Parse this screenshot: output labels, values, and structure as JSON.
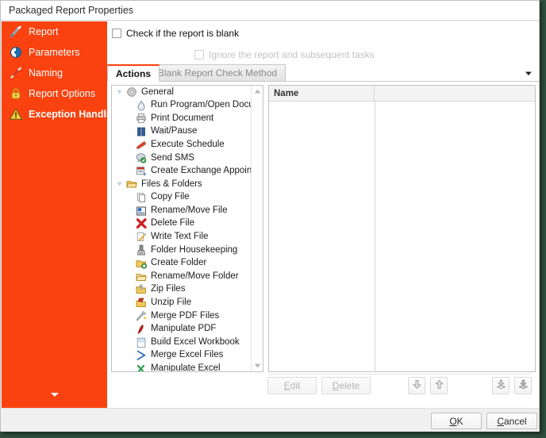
{
  "window": {
    "title": "Packaged Report Properties",
    "accent_color": "#f9420f",
    "sidebar_chevron_icon": "chevron-down-icon"
  },
  "sidebar": {
    "items": [
      {
        "label": "Report",
        "icon": "report-pencil-icon",
        "selected": false
      },
      {
        "label": "Parameters",
        "icon": "parameters-icon",
        "selected": false
      },
      {
        "label": "Naming",
        "icon": "naming-pencil-icon",
        "selected": false
      },
      {
        "label": "Report Options",
        "icon": "padlock-icon",
        "selected": false
      },
      {
        "label": "Exception Handling",
        "icon": "warning-triangle-icon",
        "selected": true
      }
    ]
  },
  "options": {
    "check_blank": {
      "label": "Check if the report is blank",
      "checked": false,
      "disabled": false
    },
    "ignore_report": {
      "label": "Ignore the report and subsequent tasks",
      "checked": false,
      "disabled": true
    }
  },
  "tabs": {
    "items": [
      {
        "label": "Actions",
        "active": true
      },
      {
        "label": "Blank Report Check Method",
        "active": false
      }
    ],
    "overflow_icon": "chevron-down-icon"
  },
  "tree": {
    "groups": [
      {
        "label": "General",
        "icon": "gear-icon",
        "expanded": true,
        "items": [
          {
            "label": "Run Program/Open Document",
            "icon": "run-program-icon"
          },
          {
            "label": "Print Document",
            "icon": "printer-icon"
          },
          {
            "label": "Wait/Pause",
            "icon": "pause-icon"
          },
          {
            "label": "Execute Schedule",
            "icon": "execute-schedule-icon"
          },
          {
            "label": "Send SMS",
            "icon": "send-sms-icon"
          },
          {
            "label": "Create Exchange Appointment",
            "icon": "exchange-appointment-icon"
          }
        ]
      },
      {
        "label": "Files & Folders",
        "icon": "open-folder-icon",
        "expanded": true,
        "items": [
          {
            "label": "Copy File",
            "icon": "copy-file-icon"
          },
          {
            "label": "Rename/Move File",
            "icon": "rename-move-file-icon"
          },
          {
            "label": "Delete File",
            "icon": "delete-file-icon"
          },
          {
            "label": "Write Text File",
            "icon": "write-text-file-icon"
          },
          {
            "label": "Folder Housekeeping",
            "icon": "folder-housekeeping-icon"
          },
          {
            "label": "Create Folder",
            "icon": "create-folder-icon"
          },
          {
            "label": "Rename/Move Folder",
            "icon": "rename-move-folder-icon"
          },
          {
            "label": "Zip Files",
            "icon": "zip-files-icon"
          },
          {
            "label": "Unzip File",
            "icon": "unzip-file-icon"
          },
          {
            "label": "Merge PDF Files",
            "icon": "merge-pdf-icon"
          },
          {
            "label": "Manipulate PDF",
            "icon": "pdf-icon"
          },
          {
            "label": "Build Excel Workbook",
            "icon": "excel-workbook-icon"
          },
          {
            "label": "Merge Excel Files",
            "icon": "merge-excel-icon"
          },
          {
            "label": "Manipulate Excel",
            "icon": "manipulate-excel-icon"
          }
        ]
      }
    ],
    "scrollbar": {
      "up_icon": "scroll-up-arrow-icon",
      "down_icon": "scroll-down-arrow-icon"
    }
  },
  "action_list": {
    "columns": [
      {
        "label": "Name"
      },
      {
        "label": ""
      }
    ],
    "rows": []
  },
  "action_buttons": {
    "edit": {
      "label": "Edit",
      "mnemonic": "E",
      "disabled": true
    },
    "delete": {
      "label": "Delete",
      "mnemonic": "D",
      "disabled": true
    },
    "move_down": {
      "icon": "move-down-arrow-icon",
      "title": "Move Down"
    },
    "move_up": {
      "icon": "move-up-arrow-icon",
      "title": "Move Up"
    },
    "import": {
      "icon": "import-icon",
      "title": "Import"
    },
    "export": {
      "icon": "export-icon",
      "title": "Export"
    }
  },
  "footer": {
    "ok": {
      "label": "OK",
      "mnemonic": "O"
    },
    "cancel": {
      "label": "Cancel",
      "mnemonic": "C"
    }
  }
}
